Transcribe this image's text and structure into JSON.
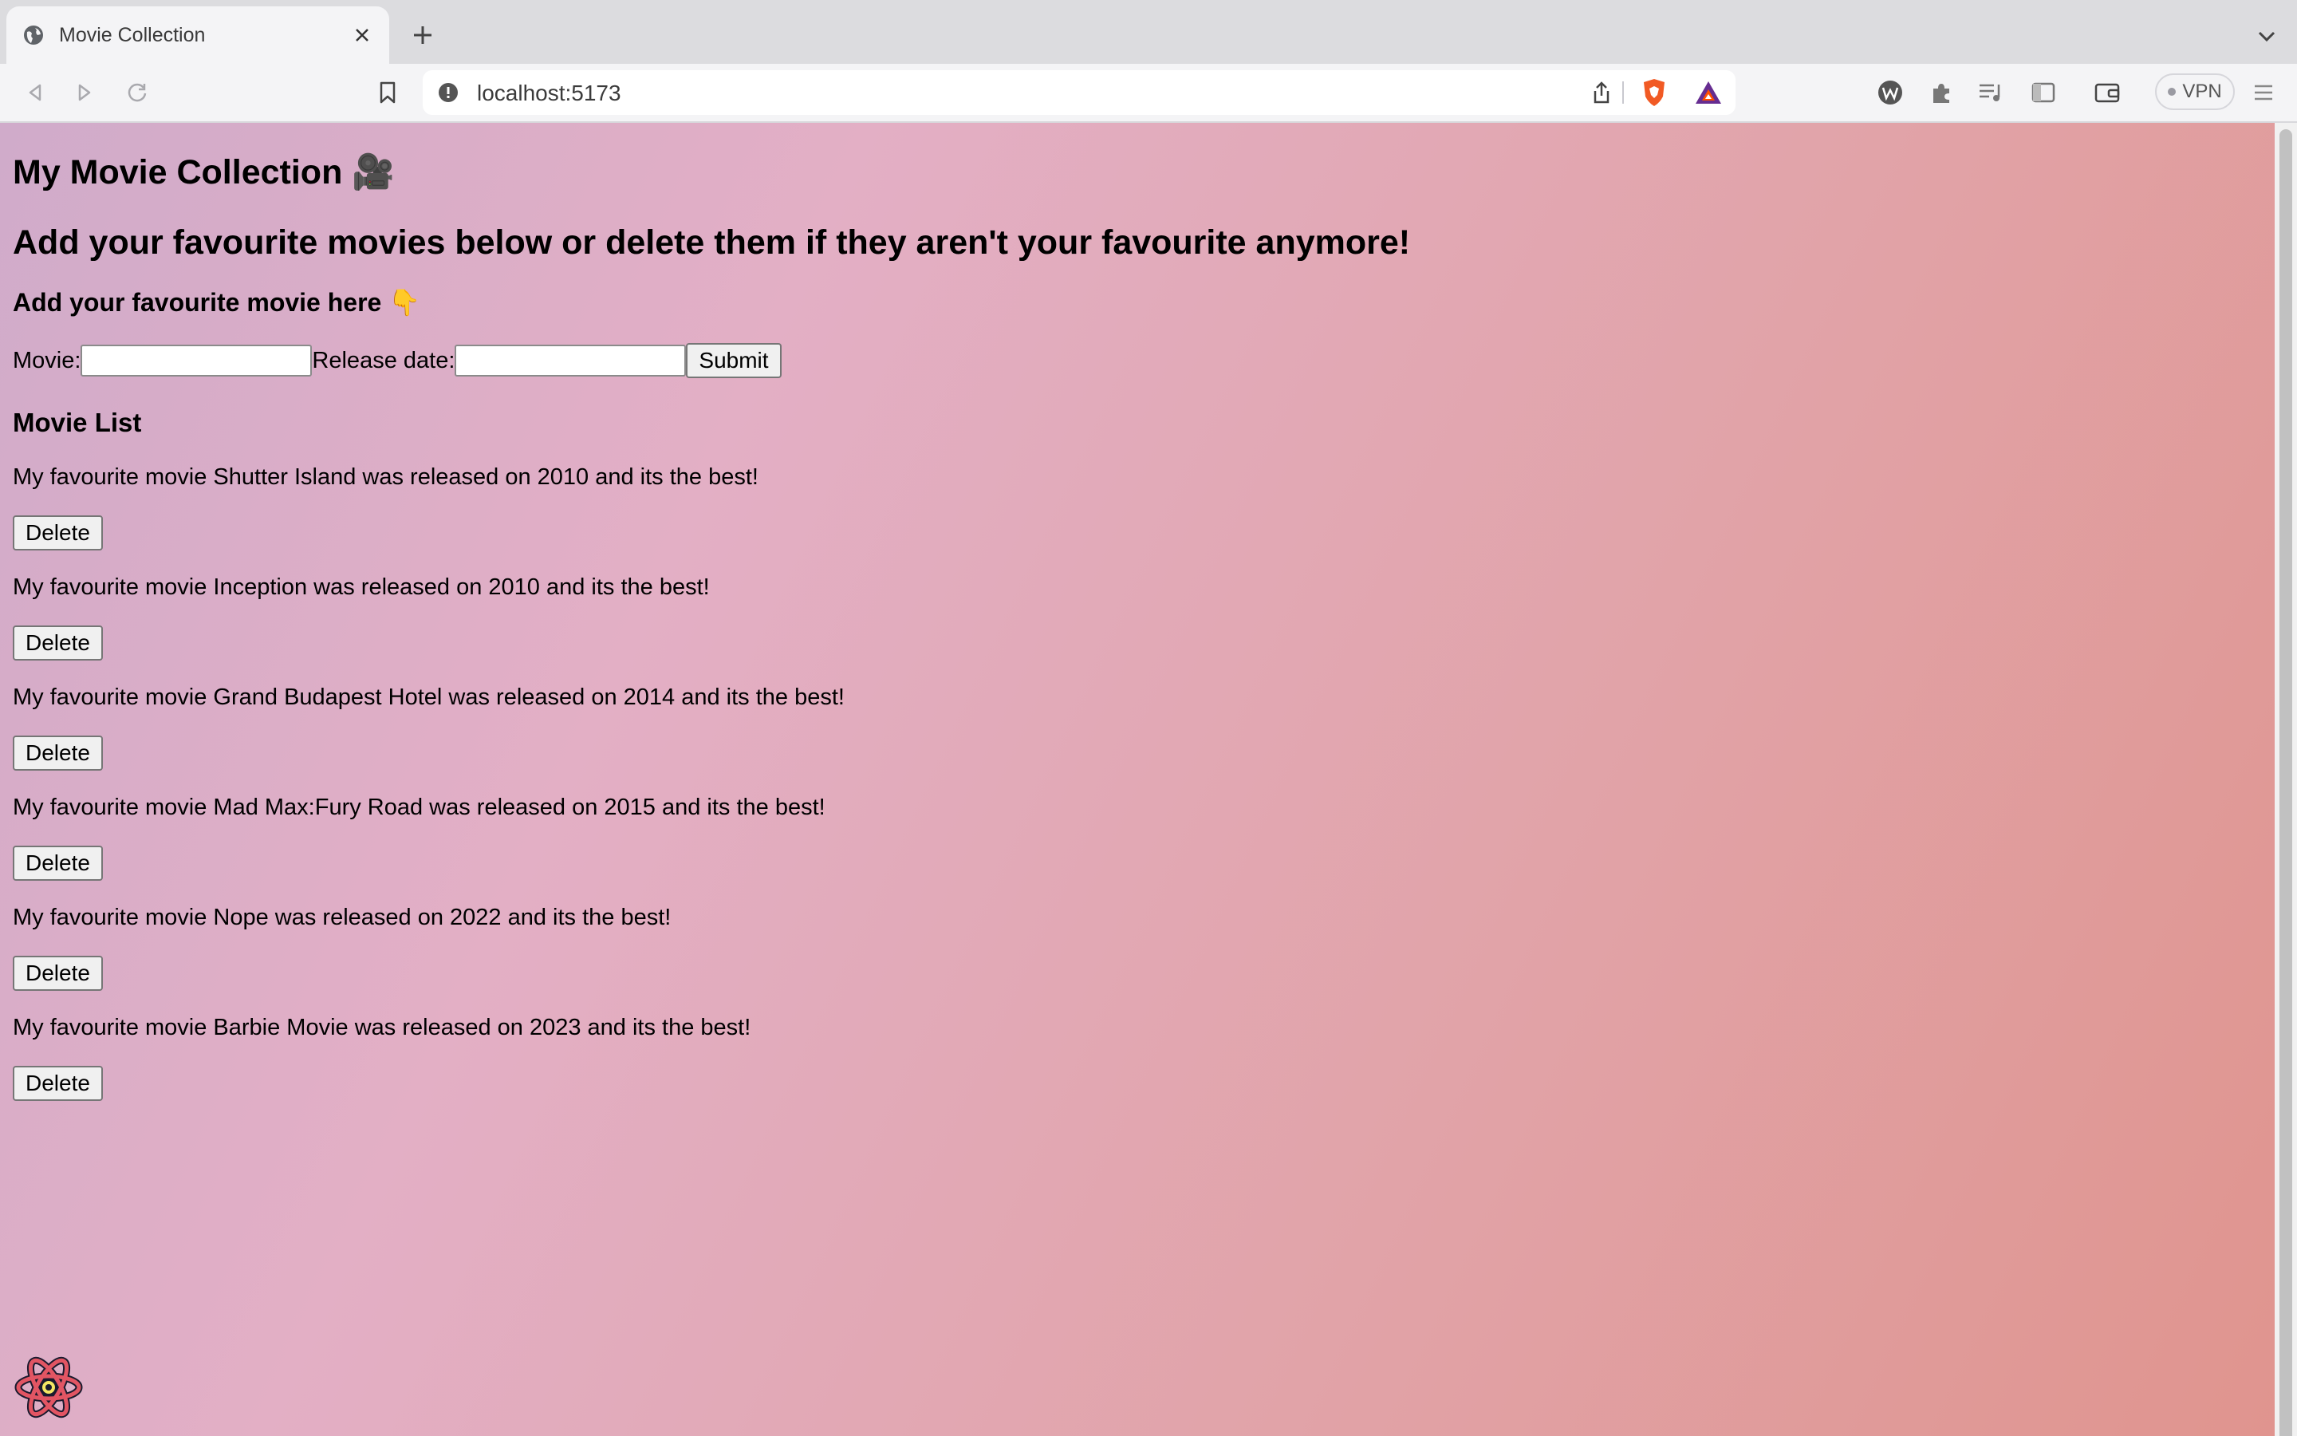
{
  "browser": {
    "tab_title": "Movie Collection",
    "url": "localhost:5173",
    "vpn_label": "VPN"
  },
  "page": {
    "title": "My Movie Collection 🎥",
    "subtitle": "Add your favourite movies below or delete them if they aren't your favourite anymore!",
    "add_heading": "Add your favourite movie here 👇",
    "form": {
      "movie_label": "Movie:",
      "movie_value": "",
      "release_label": "Release date:",
      "release_value": "",
      "submit_label": "Submit"
    },
    "list_heading": "Movie List",
    "delete_label": "Delete",
    "movies": [
      "My favourite movie Shutter Island was released on 2010 and its the best!",
      "My favourite movie Inception was released on 2010 and its the best!",
      "My favourite movie Grand Budapest Hotel was released on 2014 and its the best!",
      "My favourite movie Mad Max:Fury Road was released on 2015 and its the best!",
      "My favourite movie Nope was released on 2022 and its the best!",
      "My favourite movie Barbie Movie was released on 2023 and its the best!"
    ]
  },
  "colors": {
    "gradient_start": "#d0abca",
    "gradient_end": "#e0948e",
    "brave_orange": "#f15a24"
  }
}
